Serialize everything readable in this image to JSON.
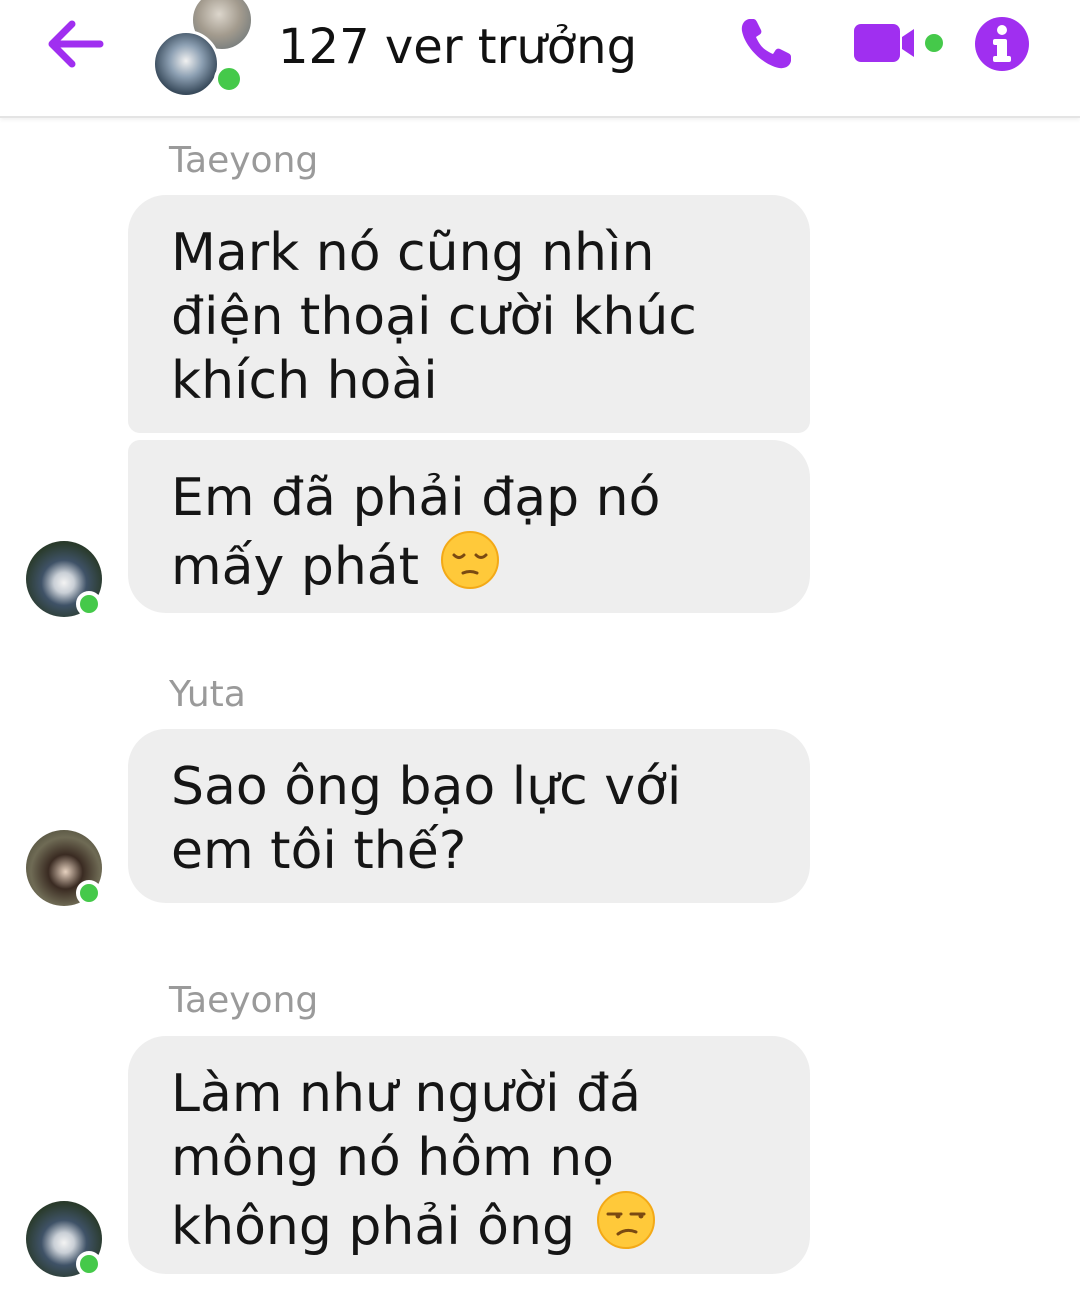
{
  "header": {
    "title": "127 ver trưởng",
    "back_icon": "arrow-left-icon",
    "phone_icon": "phone-icon",
    "video_icon": "video-camera-icon",
    "info_icon": "info-icon"
  },
  "colors": {
    "accent": "#a02ff0",
    "online": "#45c94a",
    "bubble": "#eeeeee",
    "sender_name": "#9a9a9a"
  },
  "messages": [
    {
      "sender": "Taeyong",
      "bubbles": [
        {
          "text": "Mark nó cũng nhìn điện thoại cười khúc khích hoài"
        },
        {
          "text": "Em đã phải đạp nó mấy phát",
          "emoji": "pensive-face-emoji"
        }
      ]
    },
    {
      "sender": "Yuta",
      "bubbles": [
        {
          "text": "Sao ông bạo lực với em tôi thế?"
        }
      ]
    },
    {
      "sender": "Taeyong",
      "bubbles": [
        {
          "text": "Làm như người đá mông nó hôm nọ không phải ông",
          "emoji": "unamused-face-emoji"
        }
      ]
    }
  ]
}
